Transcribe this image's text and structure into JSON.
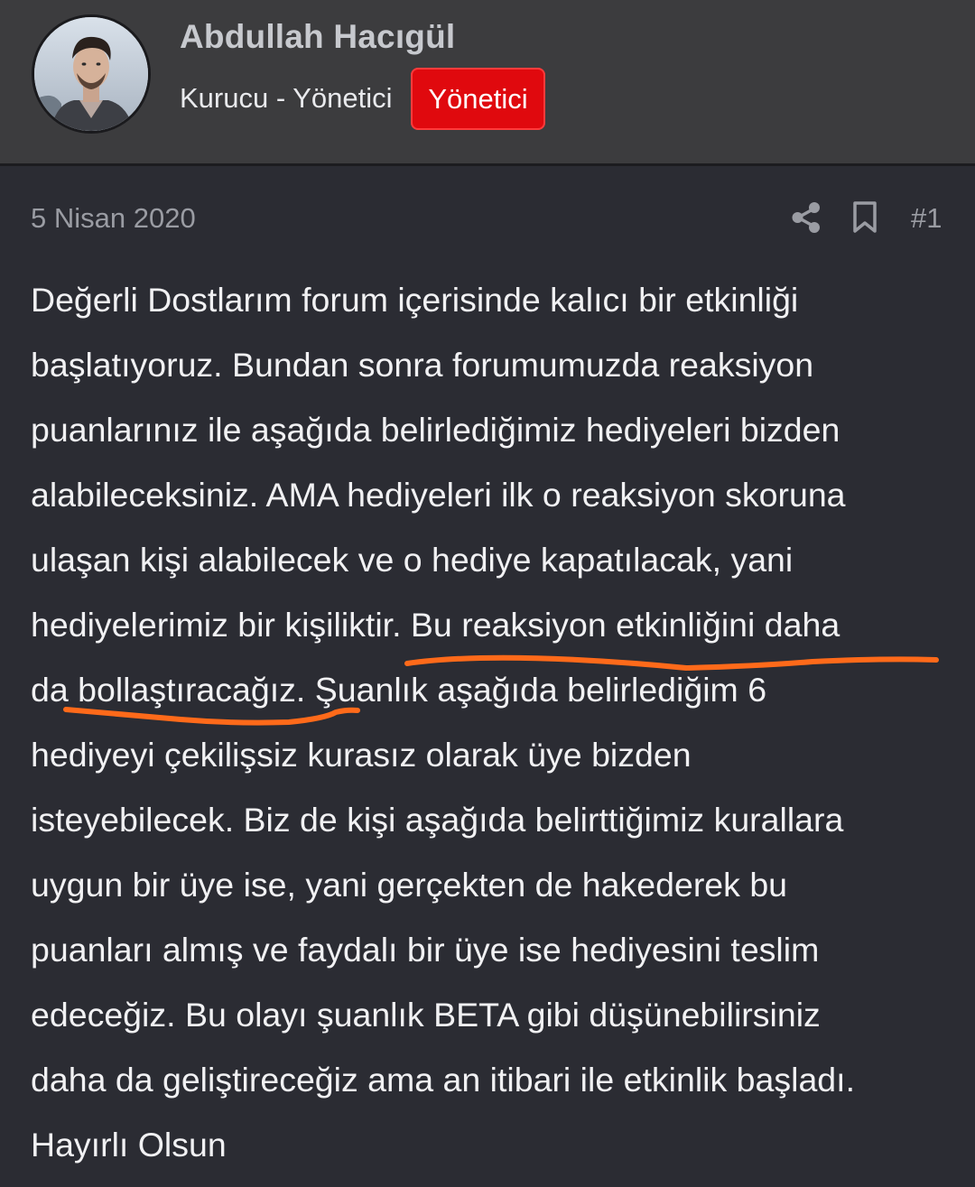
{
  "user": {
    "name": "Abdullah Hacıgül",
    "title": "Kurucu - Yönetici",
    "badge": "Yönetici"
  },
  "post": {
    "date": "5 Nisan 2020",
    "number": "#1",
    "share_icon": "share-icon",
    "bookmark_icon": "bookmark-icon",
    "lines": [
      "Değerli Dostlarım forum içerisinde kalıcı bir etkinliği",
      "başlatıyoruz. Bundan sonra forumumuzda reaksiyon",
      "puanlarınız ile aşağıda belirlediğimiz hediyeleri bizden",
      "alabileceksiniz. AMA hediyeleri ilk o reaksiyon skoruna",
      "ulaşan kişi alabilecek ve o hediye kapatılacak, yani",
      "hediyelerimiz bir kişiliktir. Bu reaksiyon etkinliğini daha",
      "da bollaştıracağız. Şuanlık aşağıda belirlediğim 6",
      "hediyeyi çekilişsiz kurasız olarak üye bizden",
      "isteyebilecek. Biz de kişi aşağıda belirttiğimiz kurallara",
      "uygun bir üye ise, yani gerçekten de hakederek bu",
      "puanları almış ve faydalı bir üye ise hediyesini teslim",
      "edeceğiz. Bu olayı şuanlık BETA gibi düşünebilirsiniz",
      "daha da geliştireceğiz ama an itibari ile etkinlik başladı.",
      "Hayırlı Olsun"
    ]
  },
  "colors": {
    "header_bg": "#3c3c3e",
    "page_bg": "#2b2c33",
    "badge_bg": "#e0090e",
    "annotation": "#ff6a1a"
  }
}
